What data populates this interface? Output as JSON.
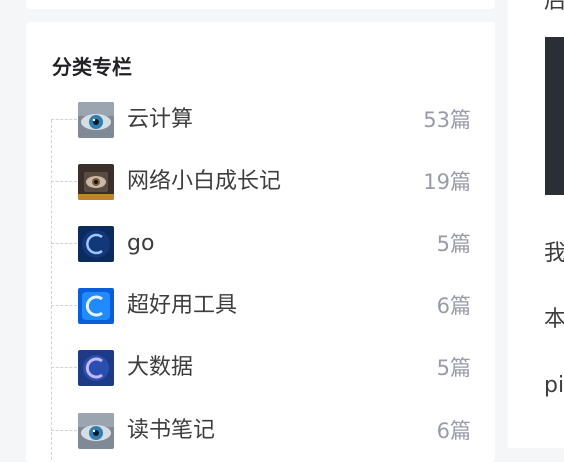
{
  "category_column": {
    "title": "分类专栏",
    "items": [
      {
        "name": "云计算",
        "count": "53篇",
        "thumb": "eye-cloud"
      },
      {
        "name": "网络小白成长记",
        "count": "19篇",
        "thumb": "eye-chip"
      },
      {
        "name": "go",
        "count": "5篇",
        "thumb": "c-logo-dark"
      },
      {
        "name": "超好用工具",
        "count": "6篇",
        "thumb": "c-logo-blue"
      },
      {
        "name": "大数据",
        "count": "5篇",
        "thumb": "c-logo-purple"
      },
      {
        "name": "读书笔记",
        "count": "6篇",
        "thumb": "eye-cloud"
      }
    ]
  },
  "right_panel": {
    "heading_fragment": "后",
    "lines": [
      "我",
      "本",
      "pi"
    ]
  },
  "colors": {
    "page_bg": "#f5f6f7",
    "card_bg": "#ffffff",
    "text_primary": "#3d3d3d",
    "text_muted": "#999aaa"
  }
}
